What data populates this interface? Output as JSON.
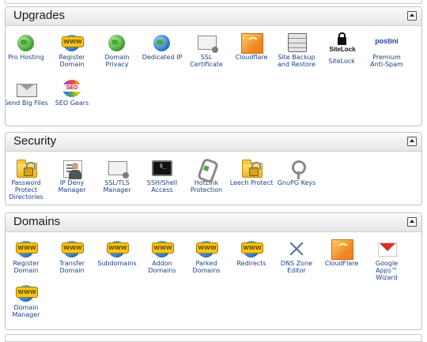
{
  "panels": {
    "upgrades": {
      "title": "Upgrades",
      "items": [
        {
          "label": "Pro Hosting",
          "icon": "pro-globe-icon"
        },
        {
          "label": "Register Domain",
          "icon": "www-globe-icon"
        },
        {
          "label": "Domain Privacy",
          "icon": "privacy-globe-icon"
        },
        {
          "label": "Dedicated IP",
          "icon": "dedicated-ip-icon"
        },
        {
          "label": "SSL Certificate",
          "icon": "certificate-icon"
        },
        {
          "label": "Cloudflare",
          "icon": "cloudflare-icon"
        },
        {
          "label": "Site Backup and Restore",
          "icon": "backup-server-icon"
        },
        {
          "label": "SiteLock",
          "icon": "sitelock-icon",
          "logo_text": "SiteLock"
        },
        {
          "label": "Premium Anti-Spam",
          "icon": "postini-icon",
          "logo_text": "postini"
        },
        {
          "label": "Send Big Files",
          "icon": "envelope-icon"
        },
        {
          "label": "SEO Gears",
          "icon": "seo-gears-icon"
        }
      ]
    },
    "security": {
      "title": "Security",
      "items": [
        {
          "label": "Password Protect Directories",
          "icon": "locked-folder-icon"
        },
        {
          "label": "IP Deny Manager",
          "icon": "ip-deny-person-icon"
        },
        {
          "label": "SSL/TLS Manager",
          "icon": "ssl-tls-icon"
        },
        {
          "label": "SSH/Shell Access",
          "icon": "terminal-icon"
        },
        {
          "label": "HotLink Protection",
          "icon": "hotlink-chain-icon"
        },
        {
          "label": "Leech Protect",
          "icon": "leech-folder-icon"
        },
        {
          "label": "GnuPG Keys",
          "icon": "keys-icon"
        }
      ]
    },
    "domains": {
      "title": "Domains",
      "items": [
        {
          "label": "Register Domain",
          "icon": "www-globe-icon"
        },
        {
          "label": "Transfer Domain",
          "icon": "www-transfer-icon"
        },
        {
          "label": "Subdomains",
          "icon": "www-subdomains-icon"
        },
        {
          "label": "Addon Domains",
          "icon": "www-addon-icon"
        },
        {
          "label": "Parked Domains",
          "icon": "www-parked-icon"
        },
        {
          "label": "Redirects",
          "icon": "www-redirects-icon"
        },
        {
          "label": "DNS Zone Editor",
          "icon": "dns-tool-icon"
        },
        {
          "label": "CloudFlare",
          "icon": "cloudflare-icon"
        },
        {
          "label": "Google Apps™ Wizard",
          "icon": "gmail-icon"
        },
        {
          "label": "Domain Manager",
          "icon": "www-globe-icon"
        }
      ]
    }
  },
  "colors": {
    "label": "#1d3f85",
    "header_bg": "#e6e6e6",
    "border": "#c3c3c3"
  }
}
